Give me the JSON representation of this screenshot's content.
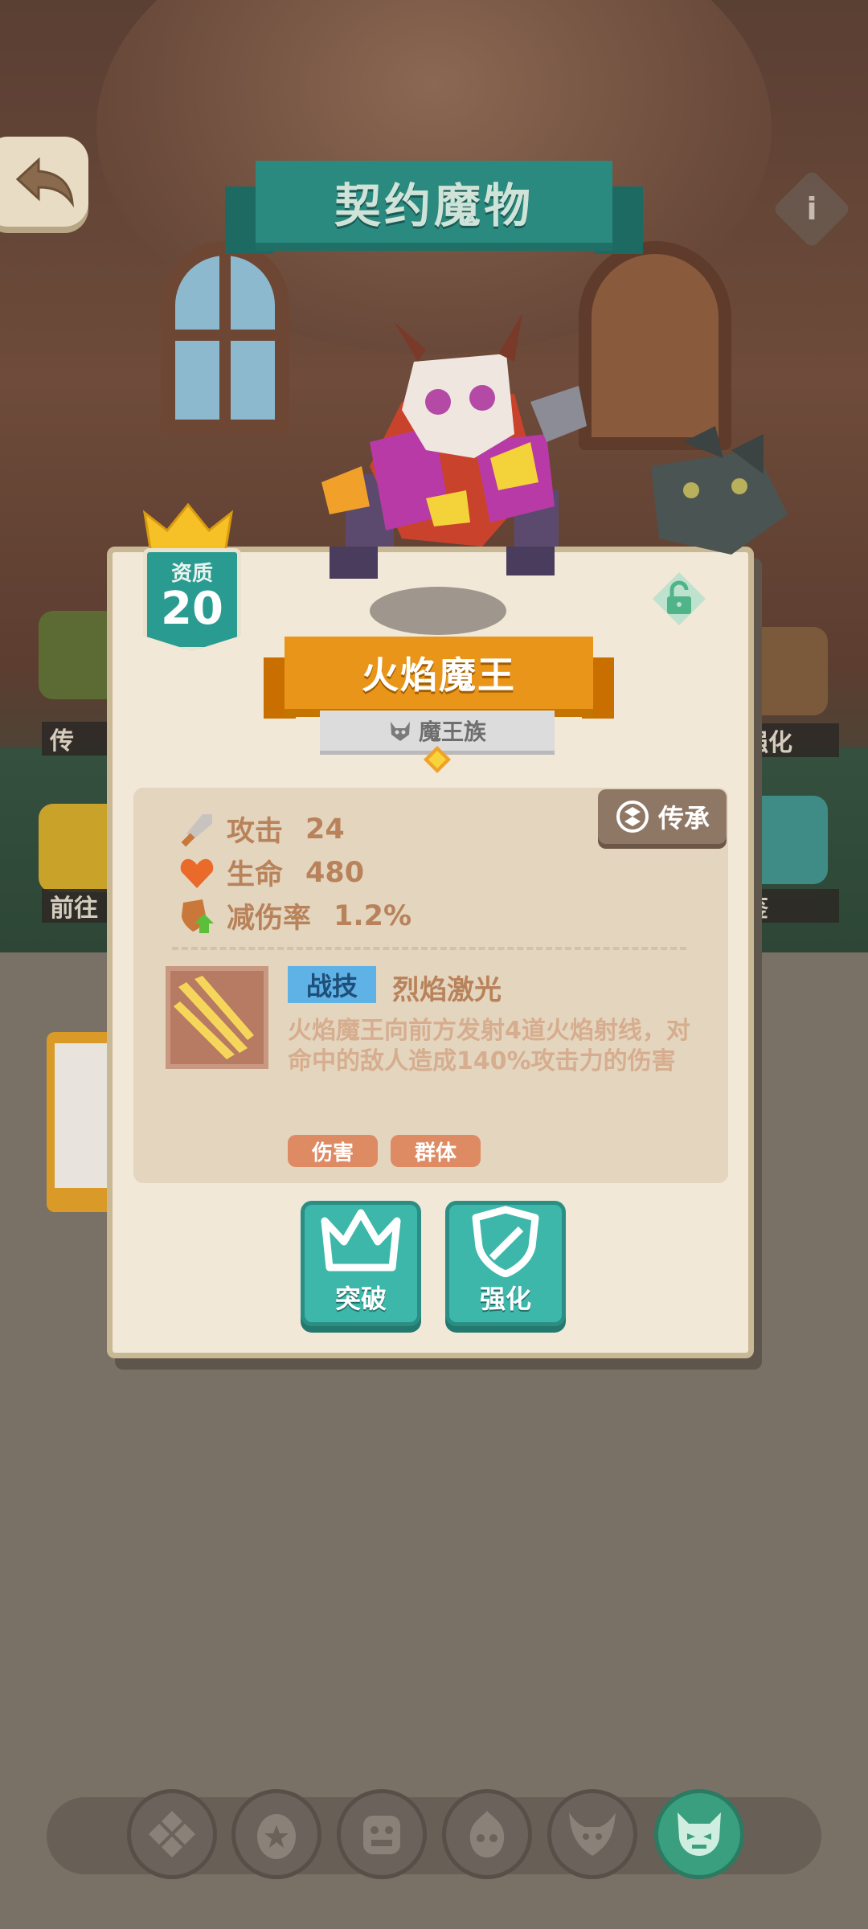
{
  "header": {
    "title": "契约魔物",
    "back_icon": "back-arrow-icon",
    "info_icon": "info-icon",
    "info_glyph": "i"
  },
  "side_labels": {
    "left_top": "传",
    "left_bottom": "前往",
    "right_top": "强化",
    "right_bottom": "鉴"
  },
  "monster": {
    "grade_label": "资质",
    "grade_value": "20",
    "name": "火焰魔王",
    "race": "魔王族",
    "stats": [
      {
        "label": "攻击",
        "value": "24",
        "icon": "sword-icon"
      },
      {
        "label": "生命",
        "value": "480",
        "icon": "heart-icon"
      },
      {
        "label": "减伤率",
        "value": "1.2%",
        "icon": "shield-up-icon"
      }
    ],
    "inherit_label": "传承",
    "skill": {
      "tag": "战技",
      "name": "烈焰激光",
      "description": "火焰魔王向前方发射4道火焰射线，对命中的敌人造成140%攻击力的伤害",
      "chips": [
        "伤害",
        "群体"
      ]
    }
  },
  "actions": {
    "breakthrough_label": "突破",
    "enhance_label": "强化"
  },
  "bottom_nav": {
    "items": [
      "clover-icon",
      "egg-star-icon",
      "ogre-face-icon",
      "flame-skull-icon",
      "horned-mask-icon",
      "demon-face-icon"
    ],
    "active_index": 5
  },
  "colors": {
    "teal": "#2a9b90",
    "orange": "#e8951a",
    "panel": "#f2e8d7",
    "stat_text": "#b8825a",
    "skill_tag": "#5fb2e6"
  }
}
